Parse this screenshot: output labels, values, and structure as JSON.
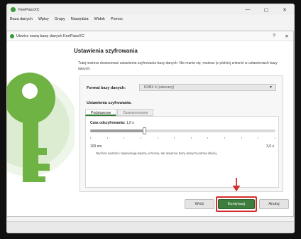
{
  "main_window": {
    "title": "KeePassXC",
    "controls": [
      "—",
      "▢",
      "✕"
    ]
  },
  "menubar": [
    "Baza danych",
    "Wpisy",
    "Grupy",
    "Narzędzia",
    "Widok",
    "Pomoc"
  ],
  "dialog": {
    "title": "Utwórz nową bazę danych KeePassXC",
    "help_glyph": "?",
    "close_glyph": "✕",
    "heading": "Ustawienia szyfrowania",
    "description": "Tutaj możesz dostosować ustawienia szyfrowania bazy danych. Nie martw się, możesz je później zmienić w ustawieniach bazy danych.",
    "format_label": "Format bazy danych:",
    "format_value": "KDBX 4 (zalecany)",
    "encryption_label": "Ustawienia szyfrowania:",
    "tabs": [
      {
        "label": "Podstawowe",
        "active": true
      },
      {
        "label": "Zaawansowane",
        "active": false
      }
    ],
    "decryption_time_label": "Czas odszyfrowania:",
    "decryption_time_value": "1,0 s",
    "slider_min_label": "100 ms",
    "slider_max_label": "3,0 s",
    "slider_level_fraction": 0.29,
    "hint": "Wyższe wartości zapewniają lepszą ochronę, ale otwarcie bazy danych potrwa dłużej.",
    "buttons": {
      "back": "Wróć",
      "continue": "Kontynuuj",
      "cancel": "Anuluj"
    }
  },
  "colors": {
    "accent": "#3d7d3d",
    "highlight": "#d32f2f",
    "key_green": "#6fb344"
  }
}
